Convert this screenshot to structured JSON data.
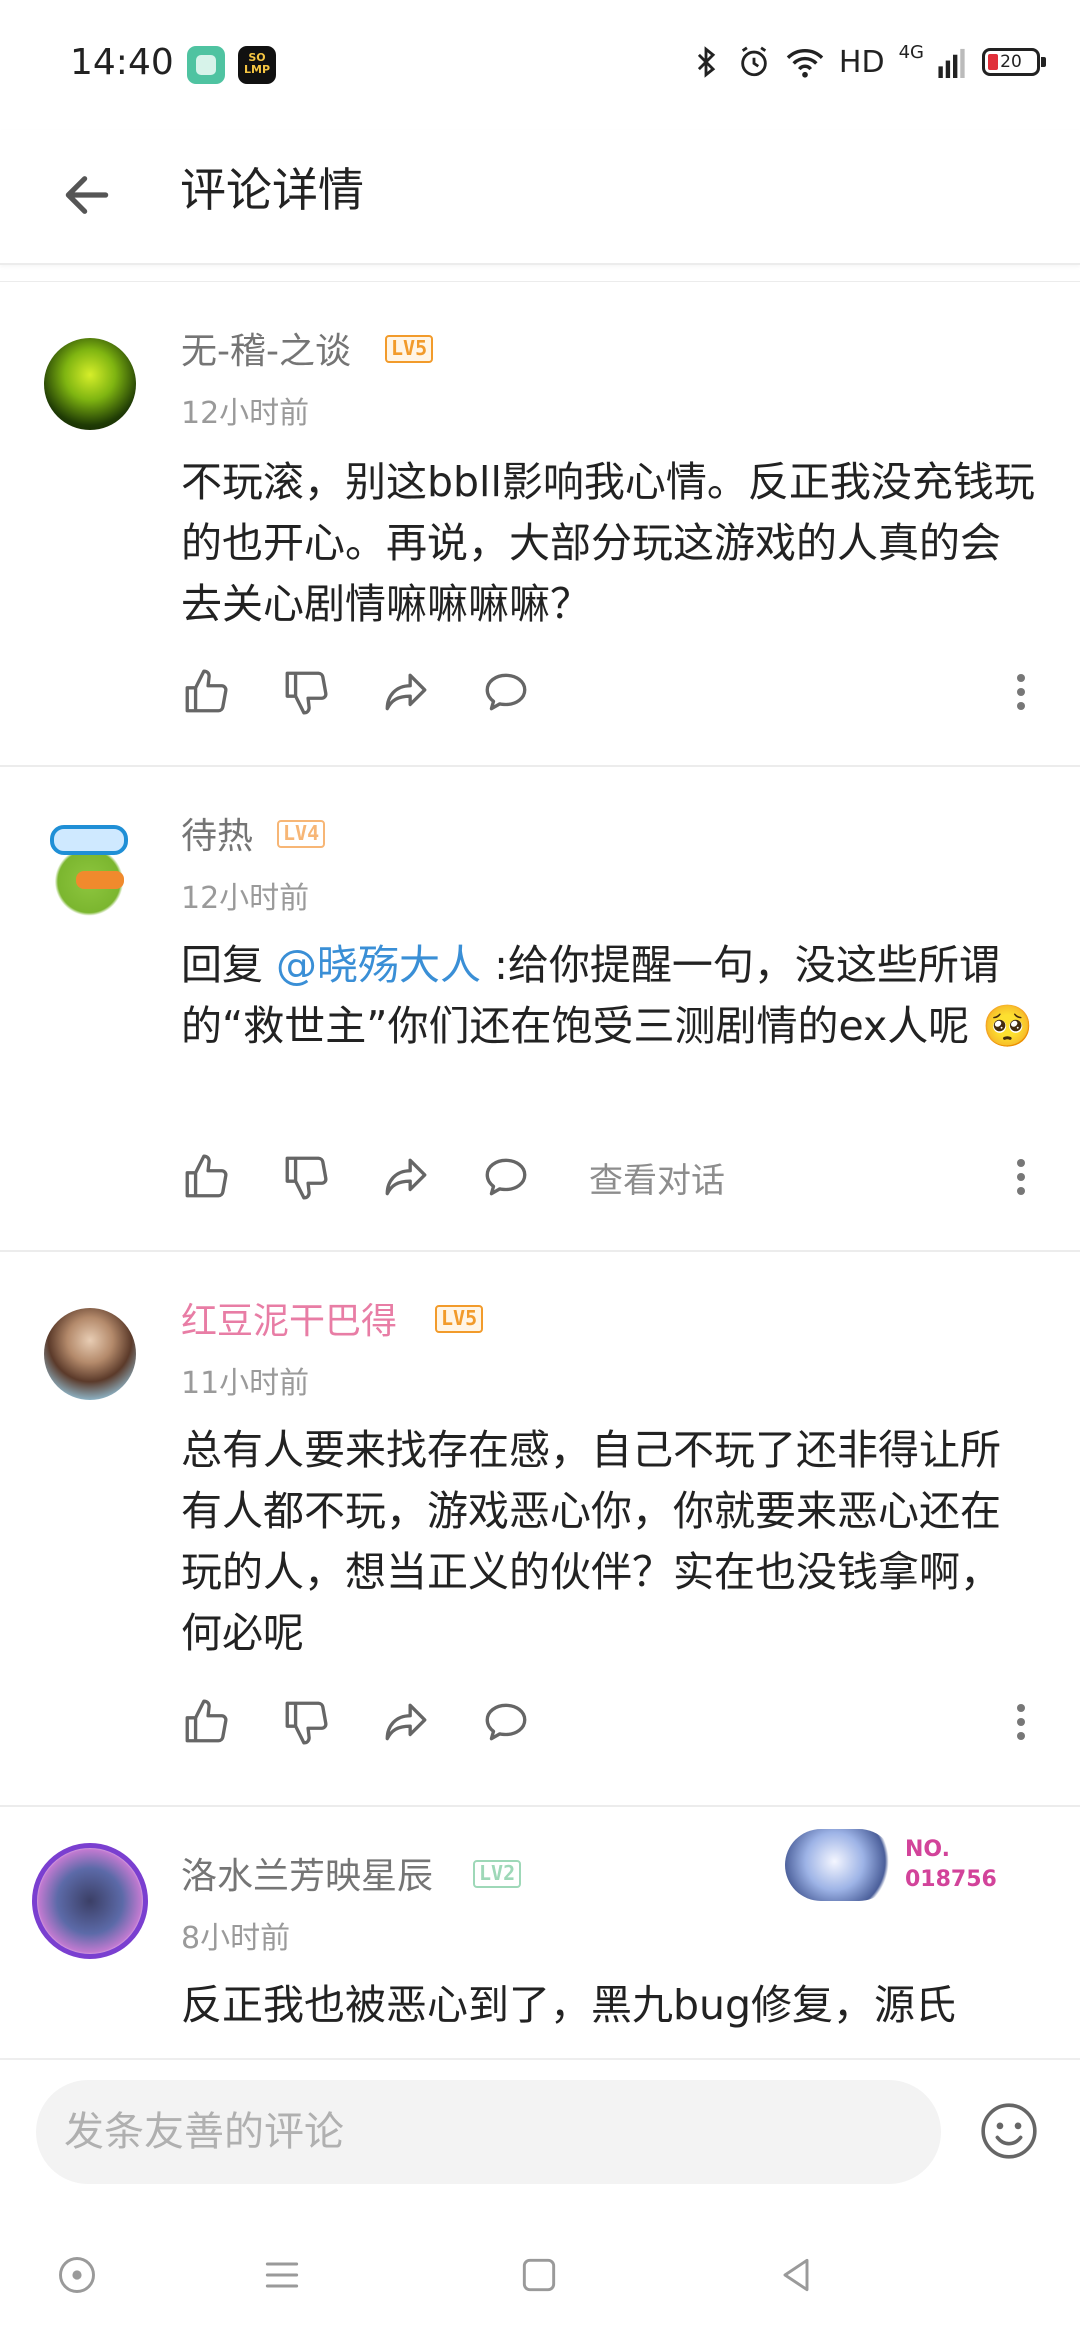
{
  "status_bar": {
    "time": "14:40",
    "app_badge_2": "SO\nLMP",
    "network_label": "HD",
    "network_type": "4G",
    "battery": "20",
    "icons": [
      "bluetooth-icon",
      "alarm-icon",
      "wifi-icon",
      "signal-icon",
      "battery-icon"
    ]
  },
  "header": {
    "title": "评论详情",
    "back_icon": "arrow-left-icon"
  },
  "comments": [
    {
      "username": "无-稽-之谈",
      "level": "LV5",
      "time": "12小时前",
      "text": "不玩滚，别这bbll影响我心情。反正我没充钱玩的也开心。再说，大部分玩这游戏的人真的会去关心剧情嘛嘛嘛嘛？"
    },
    {
      "username": "待热",
      "level": "LV4",
      "time": "12小时前",
      "reply_prefix": "回复 ",
      "mention": "@晓殇大人",
      "text": " :给你提醒一句，没这些所谓的“救世主”你们还在饱受三测剧情的ex人呢 ",
      "emoji": "🥺",
      "view_conversation": "查看对话"
    },
    {
      "username": "红豆泥干巴得",
      "level": "LV5",
      "time": "11小时前",
      "text": "总有人要来找存在感，自己不玩了还非得让所有人都不玩，游戏恶心你，你就要来恶心还在玩的人，想当正义的伙伴？实在也没钱拿啊，何必呢"
    },
    {
      "username": "洛水兰芳映星辰",
      "level": "LV2",
      "time": "8小时前",
      "badge_text": "NO.\n018756",
      "text": "反正我也被恶心到了，黑九bug修复，源氏"
    }
  ],
  "input_bar": {
    "placeholder": "发条友善的评论"
  },
  "colors": {
    "accent_link": "#3a8fd6",
    "vip_name": "#e87da5",
    "lv5": "#f29b2b"
  }
}
